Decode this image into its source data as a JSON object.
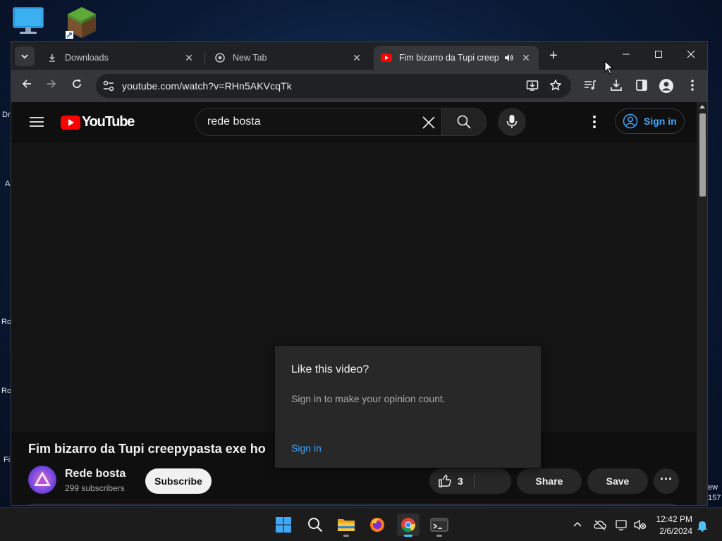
{
  "desktop": {
    "edge_labels": [
      "Dr",
      "A",
      "Ro",
      "Ro",
      "Fi",
      "ew",
      "157"
    ]
  },
  "browser": {
    "tabs": [
      {
        "title": "Downloads",
        "close": "✕"
      },
      {
        "title": "New Tab",
        "close": "✕"
      },
      {
        "title": "Fim bizarro da Tupi creepypasta",
        "close": "✕"
      }
    ],
    "new_tab": "+",
    "window_controls": {
      "minimize": "—",
      "maximize": "☐",
      "close": "✕"
    },
    "url": "youtube.com/watch?v=RHn5AKVcqTk"
  },
  "youtube": {
    "logo_text": "YouTube",
    "search_value": "rede bosta",
    "sign_in": "Sign in",
    "video_title": "Fim bizarro da Tupi creepypasta exe ho",
    "channel_name": "Rede bosta",
    "subscribers": "299 subscribers",
    "subscribe": "Subscribe",
    "likes": "3",
    "share": "Share",
    "save": "Save",
    "more": "···",
    "popup": {
      "title": "Like this video?",
      "text": "Sign in to make your opinion count.",
      "link": "Sign in"
    }
  },
  "taskbar": {
    "time": "12:42 PM",
    "date": "2/6/2024"
  },
  "colors": {
    "youtube_red": "#ff0000",
    "link_blue": "#3ea6ff",
    "page_bg": "#0f0f0f"
  }
}
